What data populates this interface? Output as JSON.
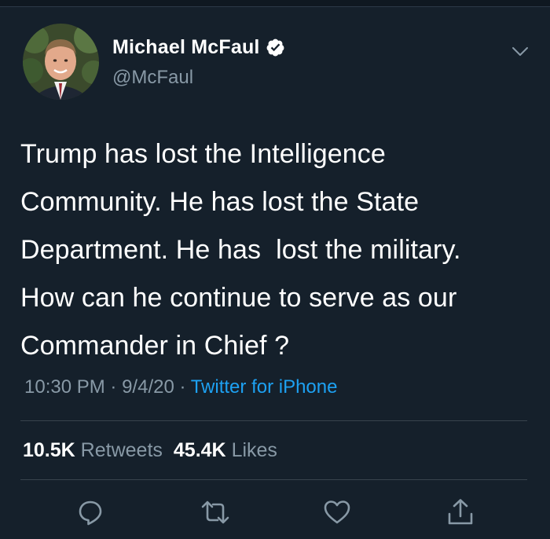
{
  "tweet": {
    "author": {
      "display_name": "Michael McFaul",
      "handle": "@McFaul",
      "verified": true
    },
    "text_lines": [
      "Trump has lost the Intelligence",
      "Community. He has lost the State",
      "Department. He has  lost the military.",
      "How can he continue to serve as our",
      "Commander in Chief ?"
    ],
    "time": "10:30 PM",
    "date": "9/4/20",
    "separator": "·",
    "source": "Twitter for iPhone",
    "retweets": {
      "count": "10.5K",
      "label": "Retweets"
    },
    "likes": {
      "count": "45.4K",
      "label": "Likes"
    }
  },
  "actions": [
    {
      "icon": "reply-icon"
    },
    {
      "icon": "retweet-icon"
    },
    {
      "icon": "like-icon"
    },
    {
      "icon": "share-icon"
    }
  ],
  "colors": {
    "background": "#15202b",
    "text": "#ffffff",
    "secondary": "#8899a6",
    "link": "#1da1f2",
    "divider": "#38444d"
  }
}
